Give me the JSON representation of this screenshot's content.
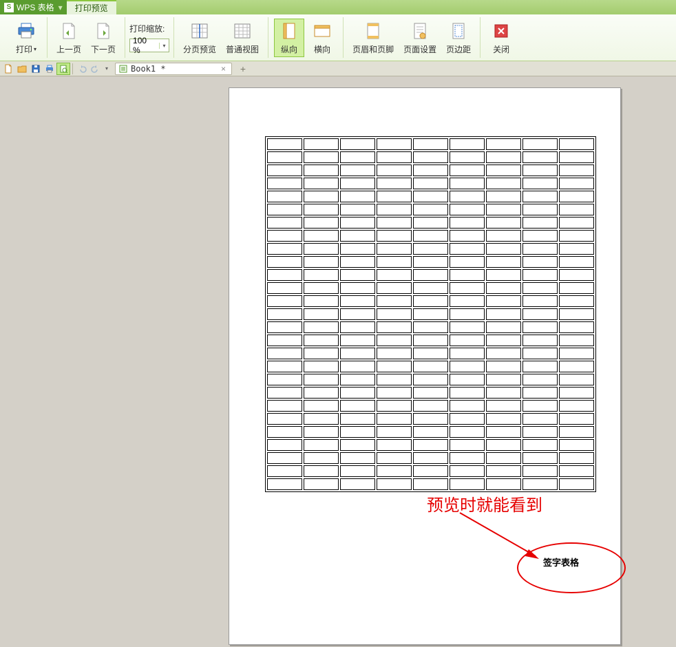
{
  "title": {
    "app_name": "WPS 表格",
    "logo_letter": "S",
    "active_tab": "打印预览"
  },
  "ribbon": {
    "print": "打印",
    "prev_page": "上一页",
    "next_page": "下一页",
    "zoom": {
      "label": "打印缩放:",
      "value": "100 %"
    },
    "page_break_preview": "分页预览",
    "normal_view": "普通视图",
    "portrait": "纵向",
    "landscape": "横向",
    "header_footer": "页眉和页脚",
    "page_setup": "页面设置",
    "margins": "页边距",
    "close": "关闭"
  },
  "qat": {
    "doc_name": "Book1 *"
  },
  "page": {
    "footer_text": "签字表格"
  },
  "annotation": {
    "text": "预览时就能看到"
  }
}
